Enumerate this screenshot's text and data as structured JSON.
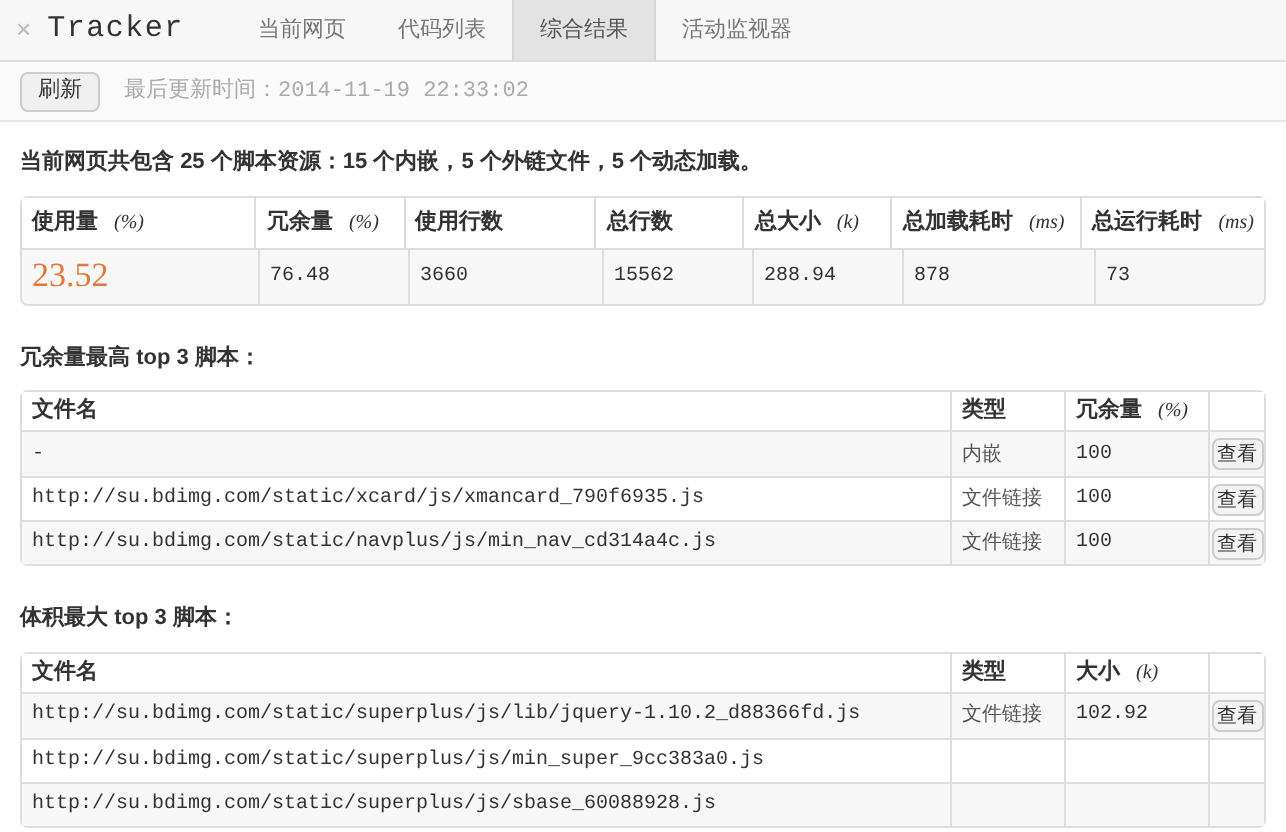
{
  "header": {
    "close": "×",
    "title": "Tracker",
    "tabs": [
      {
        "label": "当前网页",
        "selected": false
      },
      {
        "label": "代码列表",
        "selected": false
      },
      {
        "label": "综合结果",
        "selected": true
      },
      {
        "label": "活动监视器",
        "selected": false
      }
    ]
  },
  "toolbar": {
    "refresh": "刷新",
    "updated_label": "最后更新时间：",
    "updated_time": "2014-11-19 22:33:02"
  },
  "summary": "当前网页共包含 **25** 个脚本资源：**15** 个内嵌，**5** 个外链文件，**5** 个动态加载。",
  "stats": {
    "columns": [
      {
        "label": "使用量",
        "unit": "(%)"
      },
      {
        "label": "冗余量",
        "unit": "(%)"
      },
      {
        "label": "使用行数"
      },
      {
        "label": "总行数"
      },
      {
        "label": "总大小",
        "unit": "(k)"
      },
      {
        "label": "总加载耗时",
        "unit": "(ms)"
      },
      {
        "label": "总运行耗时",
        "unit": "(ms)"
      }
    ],
    "values": [
      "23.52",
      "76.48",
      "3660",
      "15562",
      "288.94",
      "878",
      "73"
    ]
  },
  "sections": [
    {
      "title": "冗余量最高 **top 3** 脚本：",
      "columns": [
        {
          "label": "文件名"
        },
        {
          "label": "类型"
        },
        {
          "label": "冗余量",
          "unit": "(%)"
        }
      ],
      "rows": [
        {
          "name": "-",
          "type": "内嵌",
          "value": "100",
          "action": "查看"
        },
        {
          "name": "http://su.bdimg.com/static/xcard/js/xmancard_790f6935.js",
          "type": "文件链接",
          "value": "100",
          "action": "查看"
        },
        {
          "name": "http://su.bdimg.com/static/navplus/js/min_nav_cd314a4c.js",
          "type": "文件链接",
          "value": "100",
          "action": "查看"
        }
      ]
    },
    {
      "title": "体积最大 **top 3** 脚本：",
      "columns": [
        {
          "label": "文件名"
        },
        {
          "label": "类型"
        },
        {
          "label": "大小",
          "unit": "(k)"
        }
      ],
      "rows": [
        {
          "name": "http://su.bdimg.com/static/superplus/js/lib/jquery-1.10.2_d88366fd.js",
          "type": "文件链接",
          "value": "102.92",
          "action": "查看"
        },
        {
          "name": "http://su.bdimg.com/static/superplus/js/min_super_9cc383a0.js"
        },
        {
          "name": "http://su.bdimg.com/static/superplus/js/sbase_60088928.js"
        }
      ]
    }
  ]
}
